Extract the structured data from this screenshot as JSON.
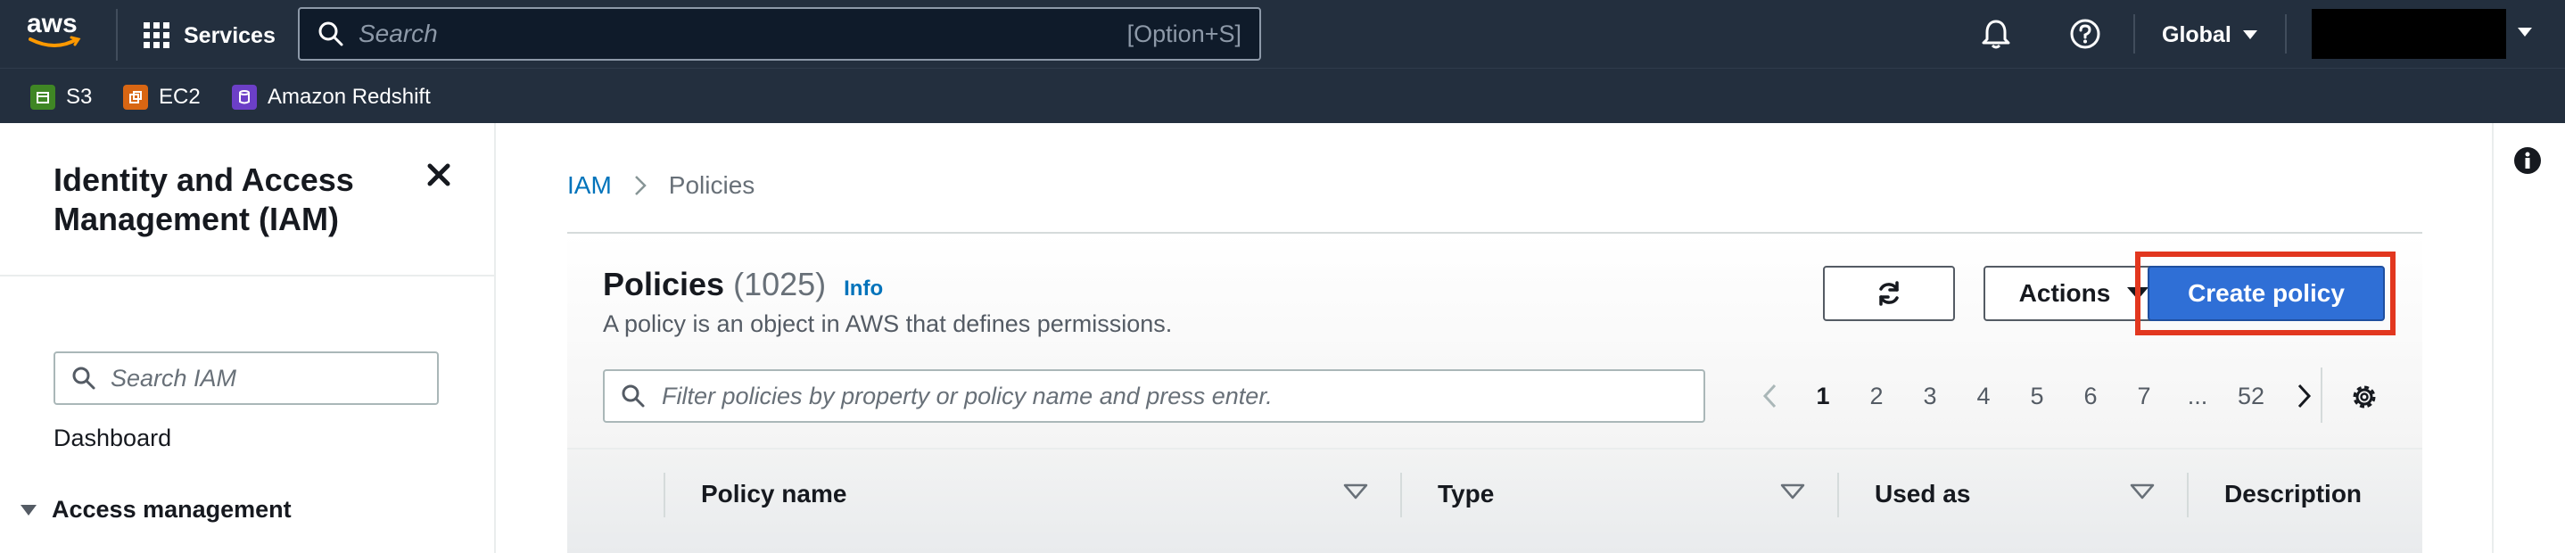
{
  "topnav": {
    "logo_text": "aws",
    "services_label": "Services",
    "search_placeholder": "Search",
    "search_shortcut": "[Option+S]",
    "region_label": "Global",
    "icons": [
      "grid-icon",
      "search-icon",
      "bell-icon",
      "help-icon",
      "caret-down-icon"
    ]
  },
  "favorites": [
    {
      "label": "S3",
      "color": "#3f8624"
    },
    {
      "label": "EC2",
      "color": "#d86613"
    },
    {
      "label": "Amazon Redshift",
      "color": "#6c3fc7"
    }
  ],
  "sidenav": {
    "title": "Identity and Access Management (IAM)",
    "search_placeholder": "Search IAM",
    "dashboard_label": "Dashboard",
    "section_label": "Access management"
  },
  "breadcrumb": {
    "root": "IAM",
    "current": "Policies"
  },
  "policies": {
    "title": "Policies",
    "count": "(1025)",
    "info_label": "Info",
    "description": "A policy is an object in AWS that defines permissions.",
    "actions_label": "Actions",
    "create_label": "Create policy",
    "filter_placeholder": "Filter policies by property or policy name and press enter.",
    "pages": [
      "1",
      "2",
      "3",
      "4",
      "5",
      "6",
      "7",
      "...",
      "52"
    ],
    "current_page": "1",
    "columns": [
      "Policy name",
      "Type",
      "Used as",
      "Description"
    ]
  },
  "colors": {
    "nav_bg": "#232f3e",
    "primary_button": "#2f6fd6",
    "link": "#0073bb",
    "highlight": "#e2371f"
  }
}
